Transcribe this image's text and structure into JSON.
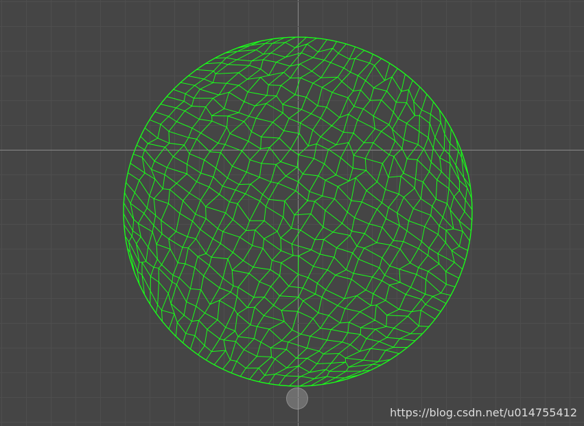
{
  "scene": {
    "background_color": "#454545",
    "grid_minor_color": "#4e4e4e",
    "grid_major_color": "#8a8a8a",
    "mesh_color": "#19ff19"
  },
  "mesh": {
    "shape": "disc",
    "topology": "quad-dominant"
  },
  "watermark": {
    "text": "https://blog.csdn.net/u014755412"
  }
}
